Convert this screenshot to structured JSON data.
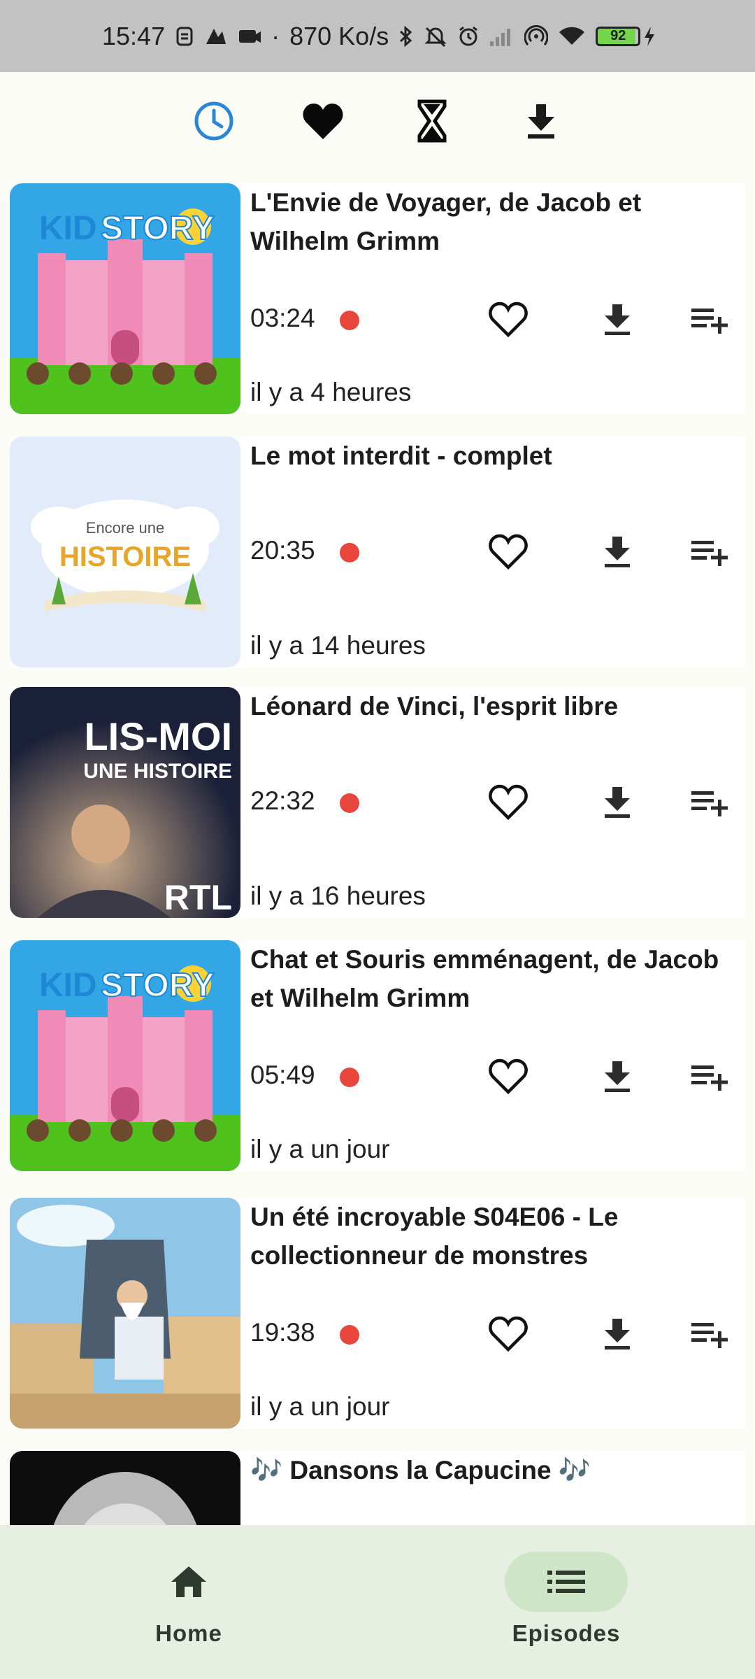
{
  "status_bar": {
    "time": "15:47",
    "net_speed": "870 Ko/s",
    "battery": "92",
    "dot": "·"
  },
  "top_tabs": [
    {
      "icon": "clock-icon",
      "active": true
    },
    {
      "icon": "heart-filled-icon",
      "active": false
    },
    {
      "icon": "hourglass-icon",
      "active": false
    },
    {
      "icon": "download-icon",
      "active": false
    }
  ],
  "episodes": [
    {
      "title": "L'Envie de Voyager, de Jacob et Wilhelm Grimm",
      "duration": "03:24",
      "ago": "il y a 4 heures",
      "thumb": "kidstory"
    },
    {
      "title": "Le mot interdit - complet",
      "duration": "20:35",
      "ago": "il y a 14 heures",
      "thumb": "encore"
    },
    {
      "title": "Léonard de Vinci, l'esprit libre",
      "duration": "22:32",
      "ago": "il y a 16 heures",
      "thumb": "lismoi"
    },
    {
      "title": "Chat et Souris emménagent, de Jacob et Wilhelm Grimm",
      "duration": "05:49",
      "ago": "il y a un jour",
      "thumb": "kidstory"
    },
    {
      "title": "Un été incroyable S04E06 - Le collectionneur de monstres",
      "duration": "19:38",
      "ago": "il y a un jour",
      "thumb": "ete"
    },
    {
      "title": "🎶 Dansons la Capucine 🎶",
      "duration": "",
      "ago": "",
      "thumb": "capucine"
    }
  ],
  "thumb_text": {
    "kidstory": {
      "a": "KID",
      "b": "STORY"
    },
    "encore": {
      "a": "Encore une",
      "b": "HISTOIRE"
    },
    "lismoi": {
      "a": "LIS-MOI",
      "b": "UNE HISTOIRE",
      "c": "RTL"
    }
  },
  "bottom_nav": {
    "home_label": "Home",
    "episodes_label": "Episodes"
  },
  "colors": {
    "accent_blue": "#2a86d6",
    "live_dot": "#e8453c",
    "nav_bg": "#e6efe2",
    "nav_pill": "#cfe5c8"
  }
}
